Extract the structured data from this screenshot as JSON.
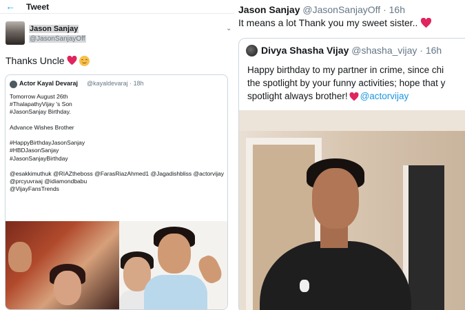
{
  "left": {
    "topbar": {
      "back_icon": "←",
      "title": "Tweet"
    },
    "author": {
      "name": "Jason Sanjay",
      "handle": "@JasonSanjayOff",
      "menu_icon": "⌄"
    },
    "tweet_text": "Thanks Uncle",
    "quote": {
      "name": "Actor Kayal Devaraj",
      "meta": "@kayaldevaraj · 18h",
      "lines": [
        "Tomorrow August 26th",
        "#ThalapathyVijay 's Son",
        "#JasonSanjay Birthday.",
        "",
        "Advance Wishes Brother",
        "",
        "#HappyBirthdayJasonSanjay",
        "#HBDJasonSanjay",
        "#JasonSanjayBirthday",
        "",
        "@esakkimuthuk @RIAZtheboss @FarasRiazAhmed1 @Jagadishbliss @actorvijay",
        "@prcyuvraaj @idiamondbabu",
        "@VijayFansTrends"
      ]
    }
  },
  "right": {
    "author": {
      "name": "Jason Sanjay",
      "handle": "@JasonSanjayOff · 16h"
    },
    "tweet_text": "It means a lot Thank you my sweet sister..",
    "quote": {
      "name": "Divya Shasha Vijay",
      "handle": "@shasha_vijay · 16h",
      "line1": "Happy birthday to my partner in crime, since chi",
      "line2": "the spotlight by your funny activities; hope that y",
      "line3a": "spotlight always brother!",
      "mention": "@actorvijay"
    }
  },
  "colors": {
    "accent": "#1da1f2",
    "heart": "#e0245e",
    "muted": "#657786"
  }
}
